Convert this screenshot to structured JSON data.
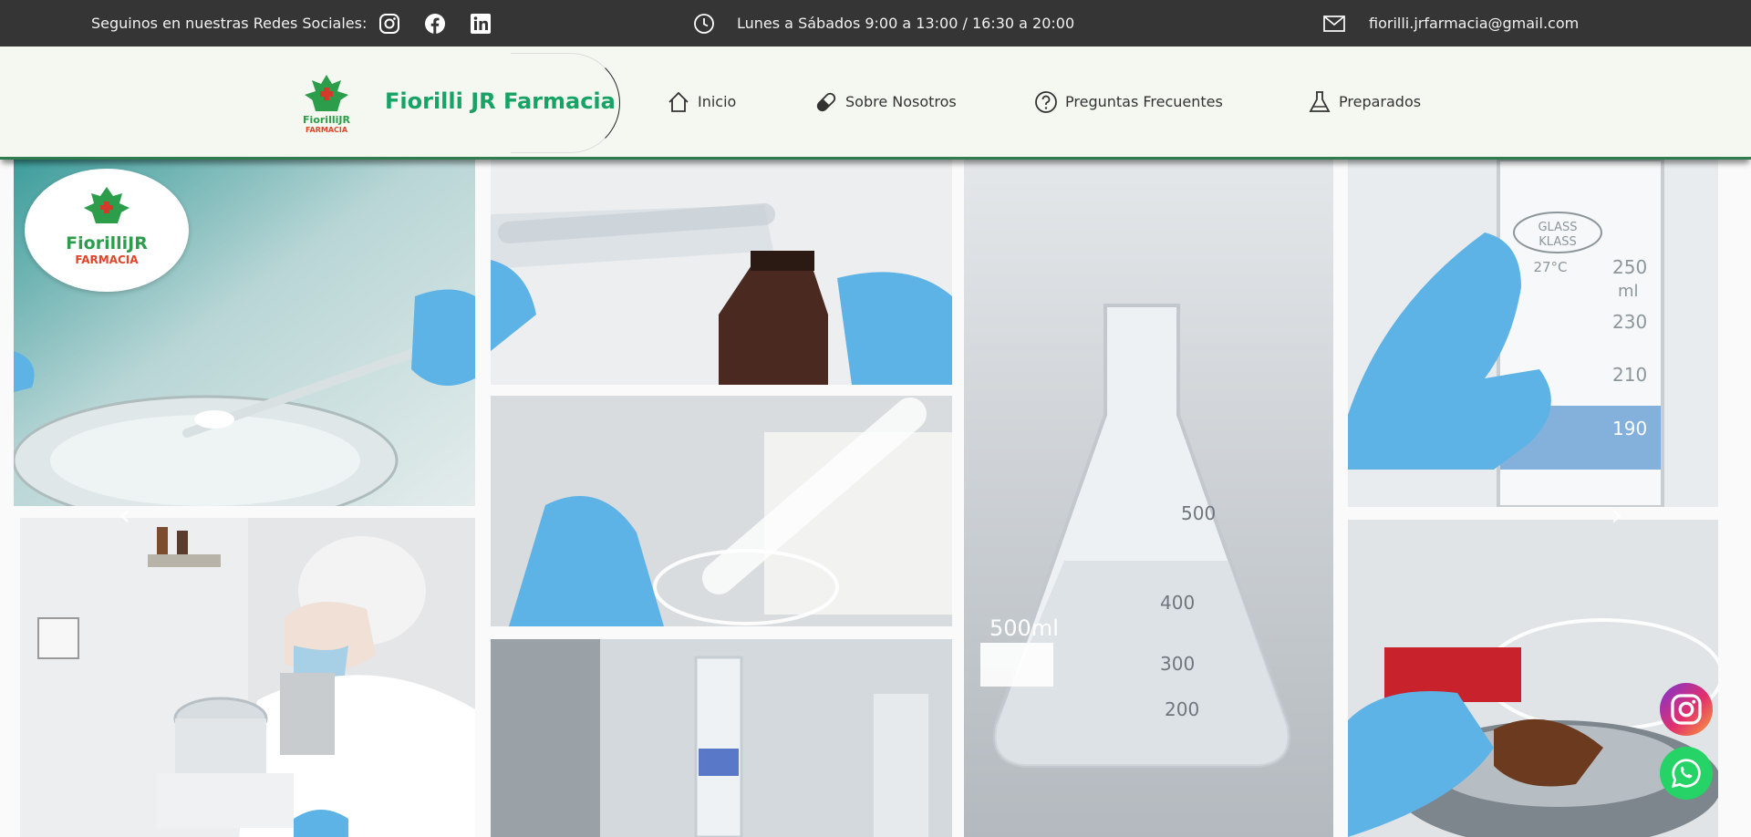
{
  "topbar": {
    "social_label": "Seguinos en nuestras Redes Sociales:",
    "social_icons": [
      "instagram-icon",
      "facebook-icon",
      "linkedin-icon"
    ],
    "hours": "Lunes a Sábados 9:00 a 13:00 / 16:30 a 20:00",
    "email": "fiorilli.jrfarmacia@gmail.com"
  },
  "header": {
    "brand": "Fiorilli JR Farmacia",
    "logo_text_top": "FiorilliJR",
    "logo_text_bottom": "FARMACIA",
    "nav": [
      {
        "label": "Inicio",
        "icon": "home-icon"
      },
      {
        "label": "Sobre Nosotros",
        "icon": "pill-icon"
      },
      {
        "label": "Preguntas Frecuentes",
        "icon": "question-icon"
      },
      {
        "label": "Preparados",
        "icon": "flask-icon"
      }
    ]
  },
  "gallery": {
    "badge_top": "FiorilliJR",
    "badge_bottom": "FARMACIA",
    "flask_label": "500ml",
    "flask_marks": [
      "500",
      "400",
      "300",
      "200"
    ],
    "cylinder_brand_top": "GLASS",
    "cylinder_brand_bottom": "KLASS",
    "cylinder_temp": "27°C",
    "cylinder_marks": [
      "250",
      "ml",
      "230",
      "210",
      "190"
    ],
    "prev_arrow": "‹",
    "next_arrow": "›"
  },
  "floating": [
    "instagram-icon",
    "whatsapp-icon"
  ],
  "colors": {
    "topbar_bg": "#353535",
    "header_bg": "#f5f8f1",
    "brand_green": "#17a365",
    "glove_blue": "#5db3e6"
  }
}
